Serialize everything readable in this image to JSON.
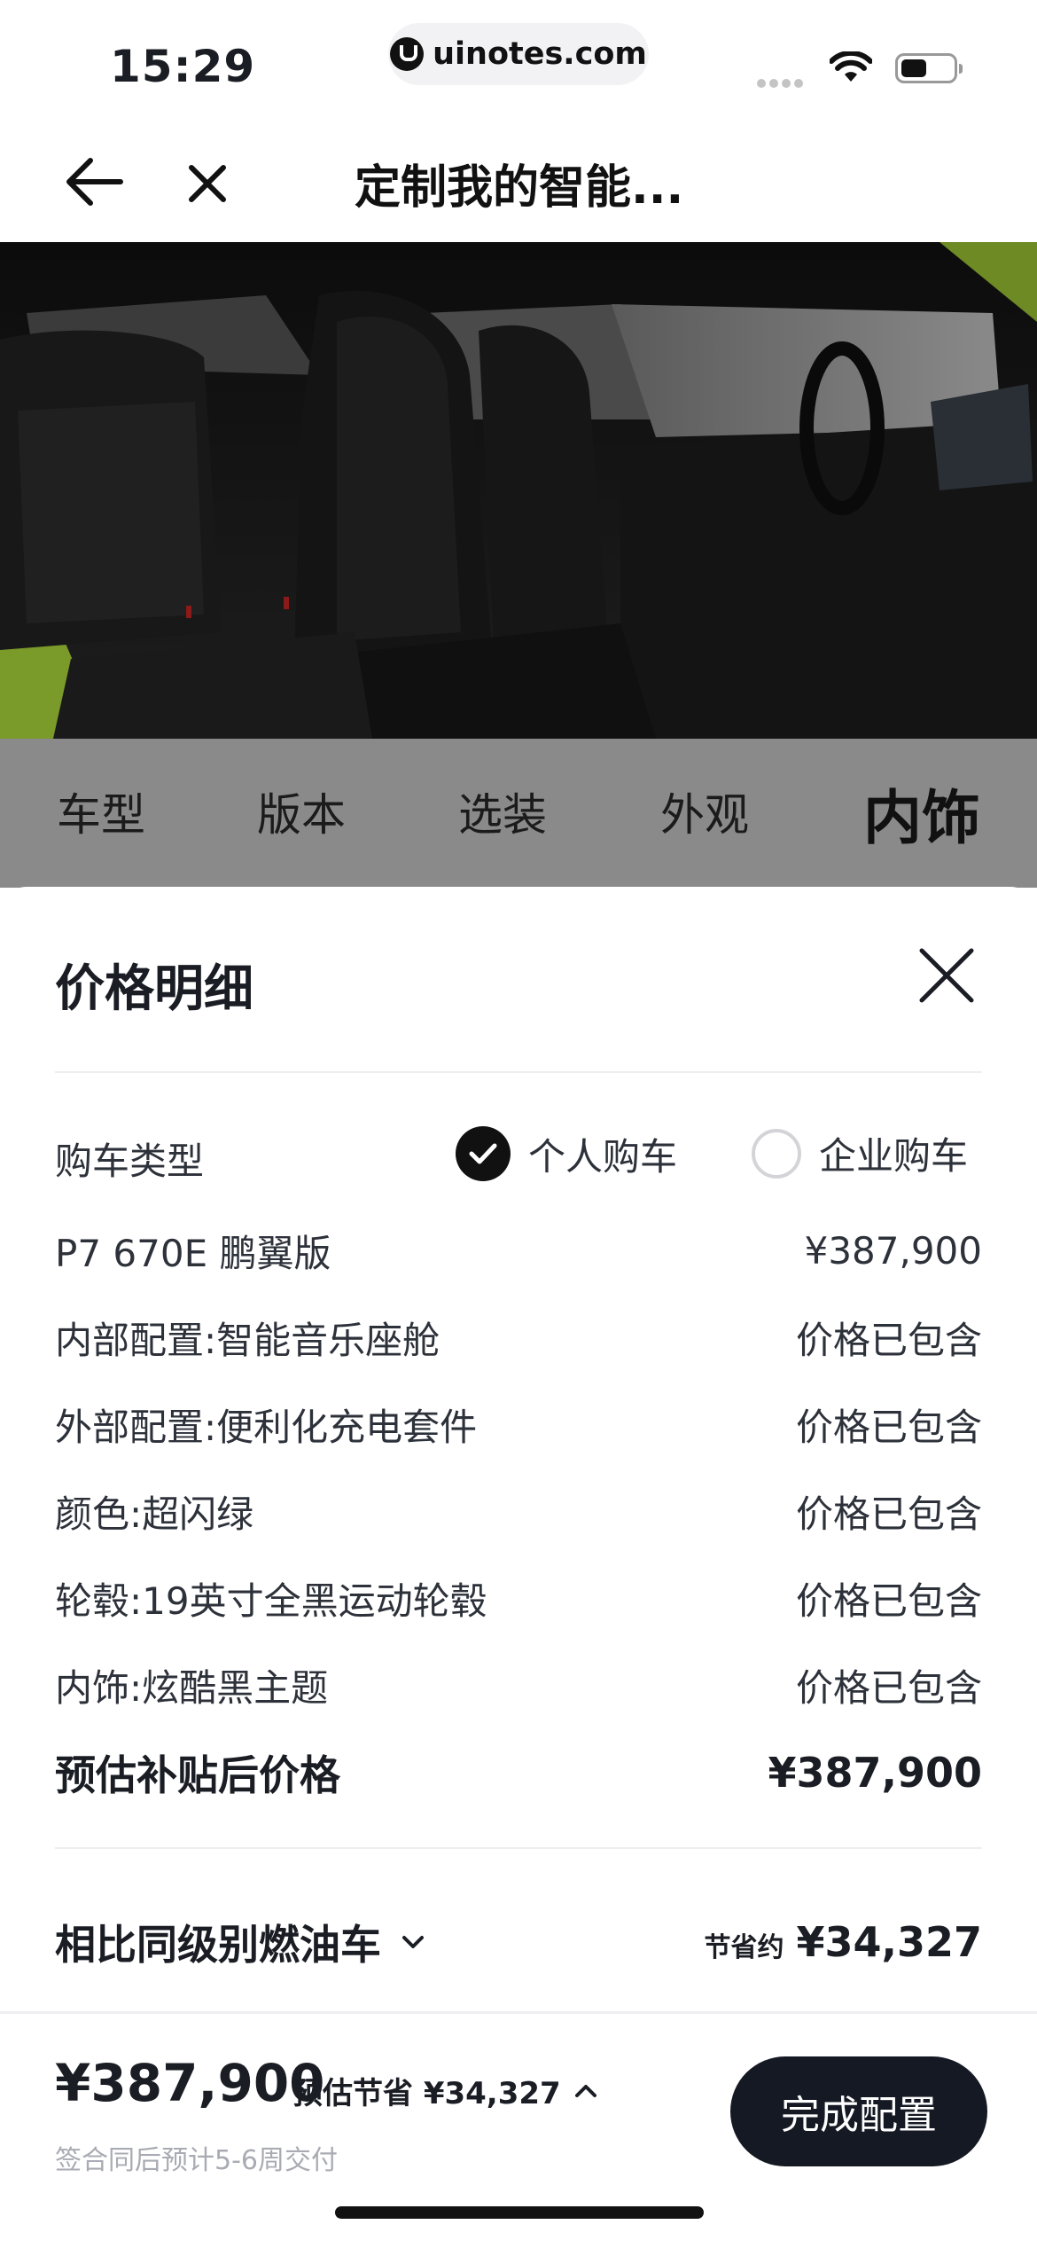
{
  "status_bar": {
    "time": "15:29",
    "url": "uinotes.com"
  },
  "nav": {
    "title": "定制我的智能..."
  },
  "tabs": [
    {
      "label": "车型",
      "active": false
    },
    {
      "label": "版本",
      "active": false
    },
    {
      "label": "选装",
      "active": false
    },
    {
      "label": "外观",
      "active": false
    },
    {
      "label": "内饰",
      "active": true
    }
  ],
  "sheet": {
    "title": "价格明细",
    "purchase_type": {
      "label": "购车类型",
      "options": [
        {
          "label": "个人购车",
          "selected": true
        },
        {
          "label": "企业购车",
          "selected": false
        }
      ]
    },
    "items": [
      {
        "name": "P7 670E 鹏翼版",
        "value": "¥387,900"
      },
      {
        "name": "内部配置:智能音乐座舱",
        "value": "价格已包含"
      },
      {
        "name": "外部配置:便利化充电套件",
        "value": "价格已包含"
      },
      {
        "name": "颜色:超闪绿",
        "value": "价格已包含"
      },
      {
        "name": "轮毂:19英寸全黑运动轮毂",
        "value": "价格已包含"
      },
      {
        "name": "内饰:炫酷黑主题",
        "value": "价格已包含"
      }
    ],
    "total": {
      "label": "预估补贴后价格",
      "value": "¥387,900"
    },
    "compare": {
      "label": "相比同级别燃油车",
      "saving_label": "节省约",
      "saving_value": "¥34,327"
    }
  },
  "footer": {
    "price": "¥387,900",
    "estimate": "预估节省 ¥34,327",
    "delivery": "签合同后预计5-6周交付",
    "finish_button": "完成配置"
  },
  "colors": {
    "accent_dark": "#141923",
    "car_green": "#7a9a2a",
    "tab_strip": "#8a8a8a"
  }
}
